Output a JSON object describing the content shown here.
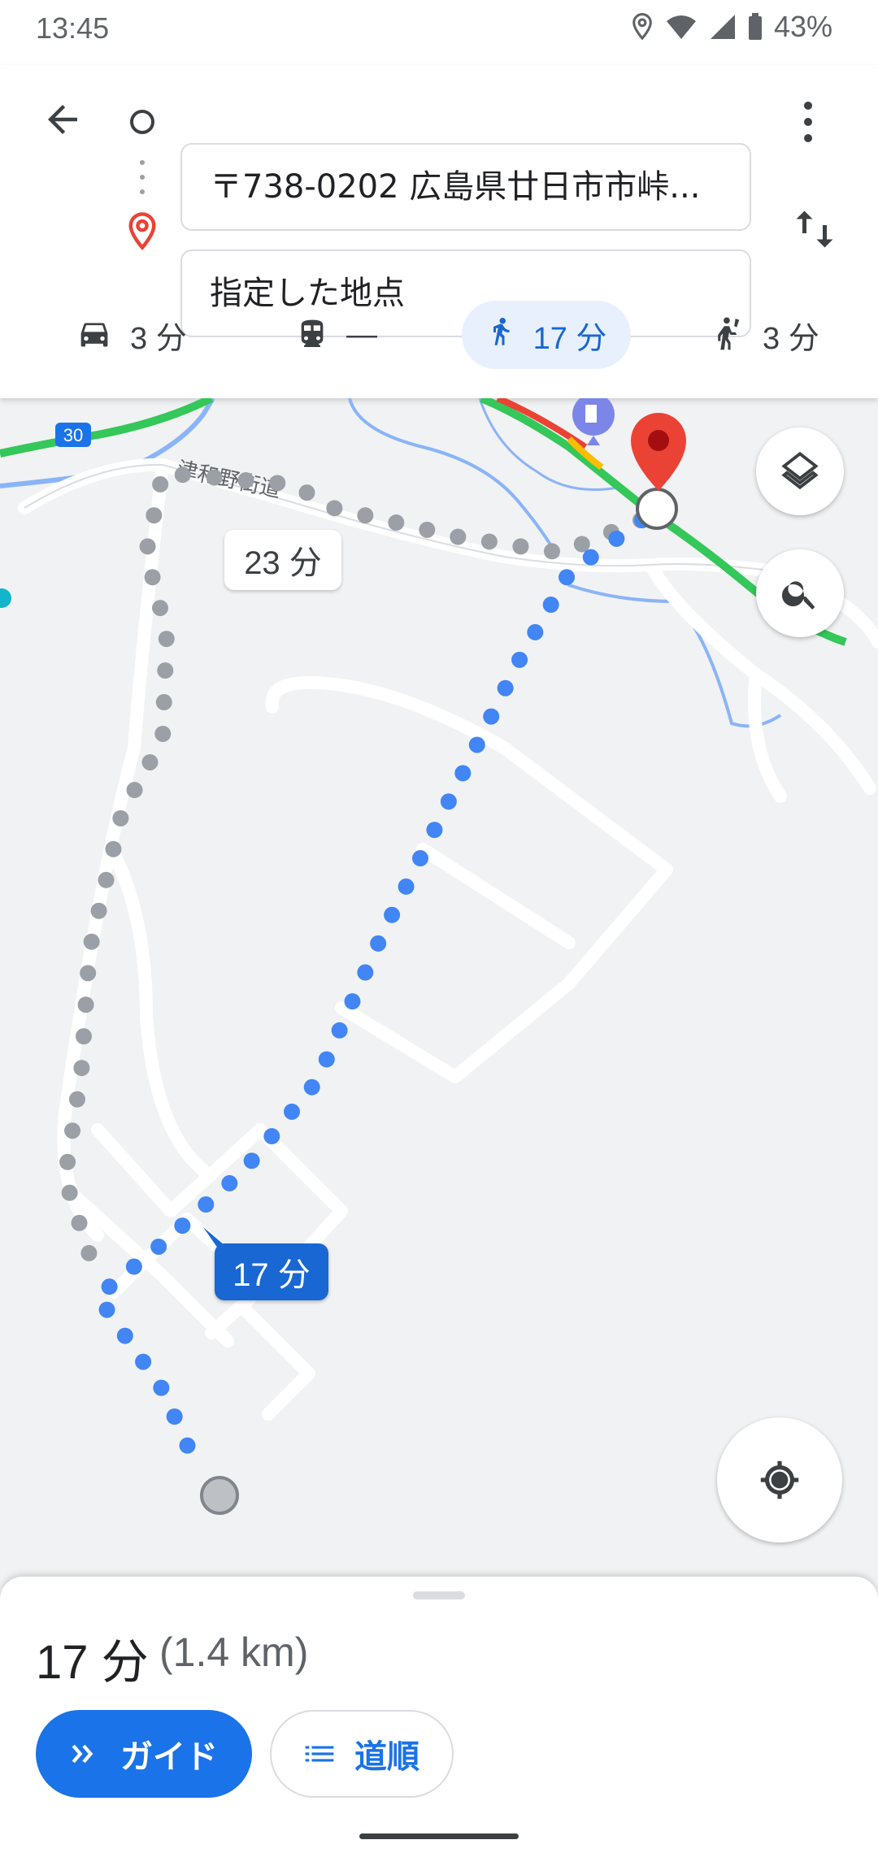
{
  "status_bar": {
    "time": "13:45",
    "battery": "43%"
  },
  "search": {
    "origin": "〒738-0202 広島県廿日市市峠...",
    "destination": "指定した地点"
  },
  "travel_modes": [
    {
      "mode": "car",
      "label": "3 分"
    },
    {
      "mode": "transit",
      "label": "—"
    },
    {
      "mode": "walk",
      "label": "17 分",
      "selected": true
    },
    {
      "mode": "ride",
      "label": "3 分"
    }
  ],
  "map": {
    "road_label": "津和野街道",
    "route_shield": "30",
    "alt_route_time": "23 分",
    "main_route_time": "17 分"
  },
  "summary": {
    "duration": "17 分",
    "distance": "(1.4 km)",
    "guide_label": "ガイド",
    "steps_label": "道順"
  },
  "colors": {
    "accent": "#1a73e8",
    "route_blue": "#4285f4",
    "route_gray": "#9aa0a6",
    "pin_red": "#ea4335",
    "traffic_green": "#34c759"
  }
}
